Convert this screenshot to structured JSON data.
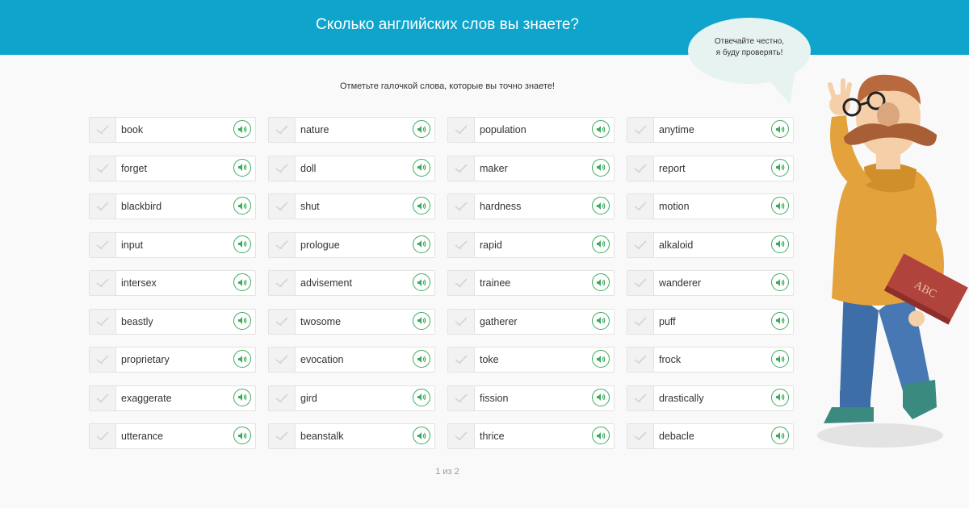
{
  "header": {
    "title": "Сколько английских слов вы знаете?"
  },
  "instruction": "Отметьте галочкой слова, которые вы точно знаете!",
  "bubble": {
    "line1": "Отвечайте честно,",
    "line2": "я буду проверять!"
  },
  "pager": "1 из 2",
  "columns": [
    [
      "book",
      "forget",
      "blackbird",
      "input",
      "intersex",
      "beastly",
      "proprietary",
      "exaggerate",
      "utterance"
    ],
    [
      "nature",
      "doll",
      "shut",
      "prologue",
      "advisement",
      "twosome",
      "evocation",
      "gird",
      "beanstalk"
    ],
    [
      "population",
      "maker",
      "hardness",
      "rapid",
      "trainee",
      "gatherer",
      "toke",
      "fission",
      "thrice"
    ],
    [
      "anytime",
      "report",
      "motion",
      "alkaloid",
      "wanderer",
      "puff",
      "frock",
      "drastically",
      "debacle"
    ]
  ],
  "icons": {
    "check": "checkmark-icon",
    "speaker": "speaker-icon"
  },
  "colors": {
    "header": "#0fa4cc",
    "speaker": "#3eaa5e",
    "bubble": "#e7f3f1"
  }
}
